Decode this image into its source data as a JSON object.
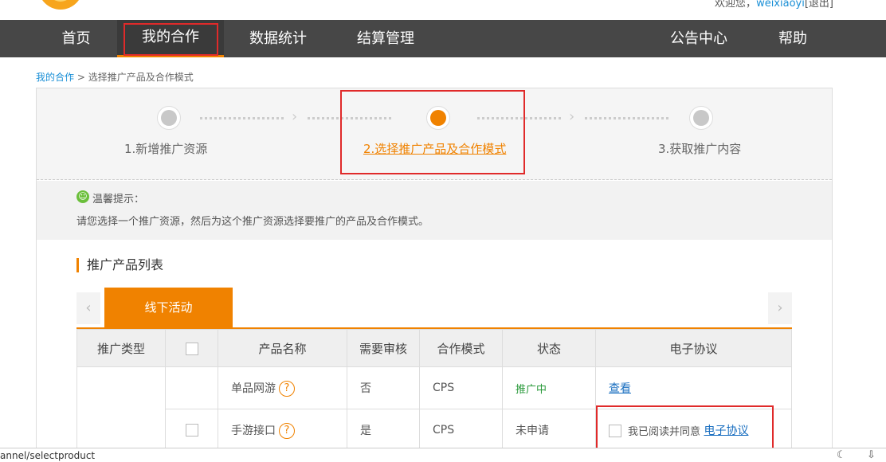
{
  "header": {
    "welcome_prefix": "欢迎您，",
    "username": "weixiaoyi",
    "logout": "[退出]"
  },
  "nav": {
    "home": "首页",
    "my_cooperation": "我的合作",
    "data_stats": "数据统计",
    "settlement": "结算管理",
    "announcements": "公告中心",
    "help": "帮助"
  },
  "breadcrumb": {
    "link": "我的合作",
    "separator": " > ",
    "current": "选择推广产品及合作模式"
  },
  "steps": [
    {
      "label": "1.新增推广资源",
      "state": "done"
    },
    {
      "label": "2.选择推广产品及合作模式",
      "state": "current"
    },
    {
      "label": "3.获取推广内容",
      "state": "todo"
    }
  ],
  "tip": {
    "icon": "smile-icon",
    "title": "温馨提示：",
    "text": "请您选择一个推广资源，然后为这个推广资源选择要推广的产品及合作模式。"
  },
  "section": {
    "title": "推广产品列表"
  },
  "tabs": {
    "active": "线下活动",
    "prev_icon": "chevron-left-icon",
    "next_icon": "chevron-right-icon"
  },
  "table": {
    "headers": [
      "推广类型",
      "",
      "产品名称",
      "需要审核",
      "合作模式",
      "状态",
      "电子协议"
    ],
    "rows": [
      {
        "product": "单品网游",
        "review": "否",
        "mode": "CPS",
        "status": "推广中",
        "agreement_link": "查看"
      },
      {
        "product": "手游接口",
        "review": "是",
        "mode": "CPS",
        "status": "未申请",
        "agree_text": "我已阅读并同意",
        "agreement_link": "电子协议"
      }
    ]
  },
  "statusbar": {
    "url": "annel/selectproduct"
  },
  "colors": {
    "accent": "#f08200",
    "nav_bg": "#474747",
    "annotation_red": "#e02a2a",
    "link": "#1a6fc0"
  }
}
